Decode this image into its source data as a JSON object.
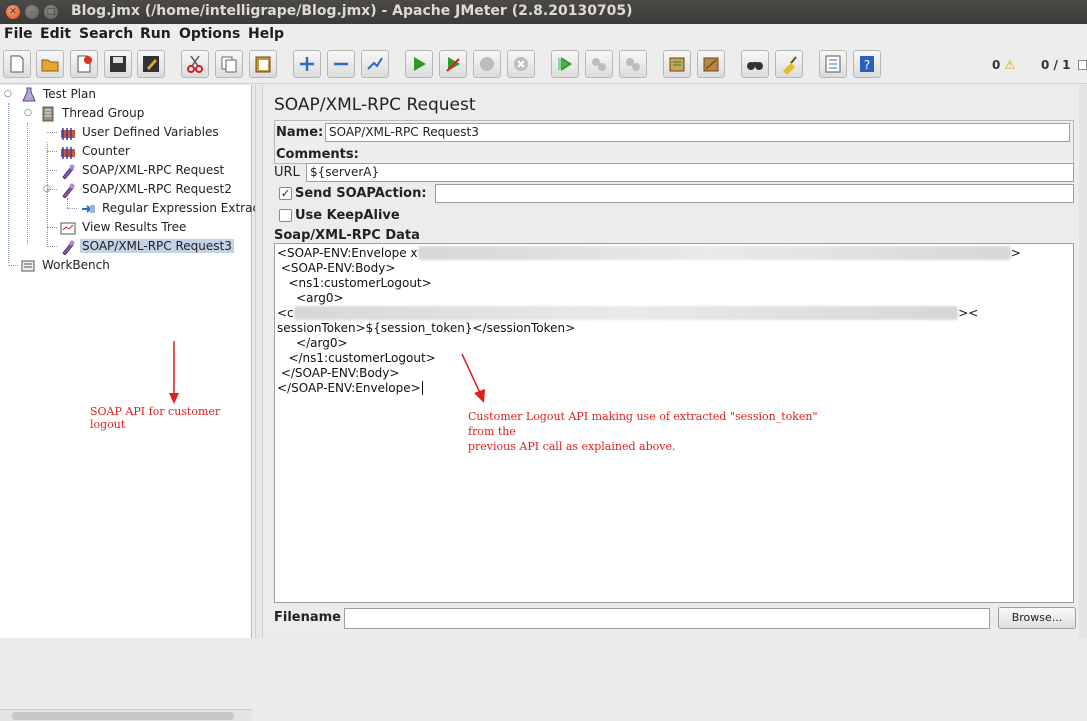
{
  "window": {
    "title": "Blog.jmx (/home/intelligrape/Blog.jmx) - Apache JMeter (2.8.20130705)"
  },
  "menubar": {
    "items": [
      "File",
      "Edit",
      "Search",
      "Run",
      "Options",
      "Help"
    ]
  },
  "toolbar": {
    "buttons": [
      "new-icon",
      "open-icon",
      "close-icon",
      "save-icon",
      "save-as-icon",
      "cut-icon",
      "copy-icon",
      "paste-icon",
      "expand-icon",
      "collapse-icon",
      "toggle-icon",
      "start-icon",
      "start-no-timers-icon",
      "stop-icon",
      "shutdown-icon",
      "remote-start-icon",
      "remote-stop-icon",
      "remote-shutdown-icon",
      "clear-icon",
      "clear-all-icon",
      "search-icon",
      "reset-search-icon",
      "function-helper-icon",
      "help-icon"
    ],
    "warning_count": "0",
    "threads": "0 / 1"
  },
  "tree": {
    "nodes": [
      {
        "label": "Test Plan",
        "icon": "test-plan-icon"
      },
      {
        "label": "Thread Group",
        "icon": "thread-group-icon"
      },
      {
        "label": "User Defined Variables",
        "icon": "config-element-icon"
      },
      {
        "label": "Counter",
        "icon": "config-element-icon"
      },
      {
        "label": "SOAP/XML-RPC Request",
        "icon": "sampler-icon"
      },
      {
        "label": "SOAP/XML-RPC Request2",
        "icon": "sampler-icon"
      },
      {
        "label": "Regular Expression Extrac",
        "icon": "post-processor-icon"
      },
      {
        "label": "View Results Tree",
        "icon": "listener-icon"
      },
      {
        "label": "SOAP/XML-RPC Request3",
        "icon": "sampler-icon",
        "selected": true
      },
      {
        "label": "WorkBench",
        "icon": "workbench-icon"
      }
    ],
    "annotation": "SOAP API for customer logout"
  },
  "panel": {
    "title": "SOAP/XML-RPC Request",
    "name_label": "Name:",
    "name_value": "SOAP/XML-RPC Request3",
    "comments_label": "Comments:",
    "url_label": "URL",
    "url_value": "${serverA}",
    "send_soapaction_label": "Send SOAPAction:",
    "send_soapaction_checked": true,
    "soapaction_value": "",
    "keepalive_label": "Use KeepAlive",
    "keepalive_checked": false,
    "data_label": "Soap/XML-RPC Data",
    "data_lines": [
      "<SOAP-ENV:Envelope x",
      " <SOAP-ENV:Body>",
      "   <ns1:customerLogout>",
      "     <arg0>",
      "",
      "<c",
      "sessionToken>${session_token}</sessionToken>",
      "     </arg0>",
      "   </ns1:customerLogout>",
      " </SOAP-ENV:Body>",
      "</SOAP-ENV:Envelope>"
    ],
    "annotation_line1": "Customer Logout API making use of extracted \"session_token\" from the",
    "annotation_line2": "previous API call as explained above.",
    "filename_label": "Filename",
    "filename_value": "",
    "browse_label": "Browse..."
  },
  "colors": {
    "annotation": "#e11d1d",
    "selection": "#c4d2e6",
    "titlebar": "#3c3b37"
  }
}
